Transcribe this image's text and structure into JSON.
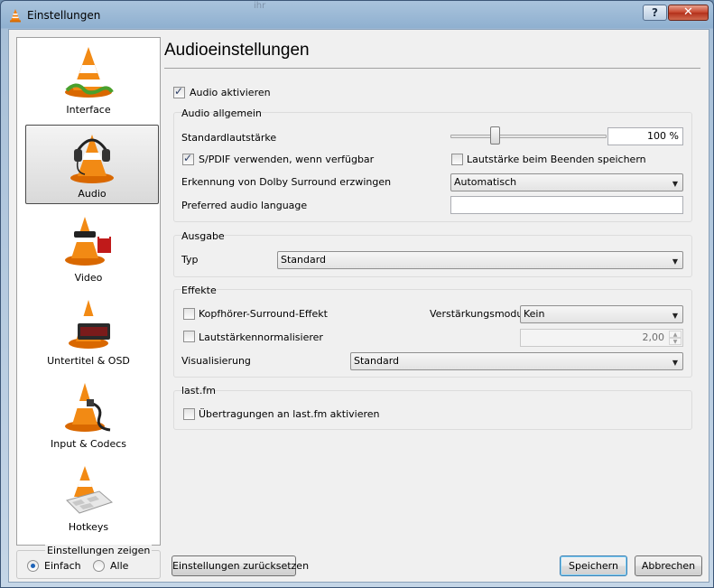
{
  "window": {
    "title": "Einstellungen",
    "behind_title_text": "ihr"
  },
  "titlebar": {
    "help_glyph": "?",
    "close_glyph": "✕"
  },
  "sidebar": {
    "items": [
      {
        "label": "Interface",
        "icon": "vlc-cone-interface-icon"
      },
      {
        "label": "Audio",
        "icon": "vlc-cone-headphones-icon",
        "selected": true
      },
      {
        "label": "Video",
        "icon": "vlc-cone-video-icon"
      },
      {
        "label": "Untertitel & OSD",
        "icon": "vlc-cone-subtitle-icon"
      },
      {
        "label": "Input & Codecs",
        "icon": "vlc-cone-cable-icon"
      },
      {
        "label": "Hotkeys",
        "icon": "vlc-cone-keyboard-icon"
      }
    ]
  },
  "show_settings": {
    "title": "Einstellungen zeigen",
    "simple": "Einfach",
    "all": "Alle",
    "selected": "Einfach"
  },
  "main": {
    "heading": "Audioeinstellungen",
    "enable_audio": {
      "label": "Audio aktivieren",
      "checked": true
    },
    "general": {
      "title": "Audio allgemein",
      "volume_label": "Standardlautstärke",
      "volume_value": "100 %",
      "volume_level": 0.27,
      "spdif": {
        "label": "S/PDIF verwenden, wenn verfügbar",
        "checked": true
      },
      "save_volume": {
        "label": "Lautstärke beim Beenden speichern",
        "checked": false
      },
      "dolby_label": "Erkennung von Dolby Surround erzwingen",
      "dolby_value": "Automatisch",
      "language_label": "Preferred audio language",
      "language_value": ""
    },
    "output": {
      "title": "Ausgabe",
      "type_label": "Typ",
      "type_value": "Standard"
    },
    "effects": {
      "title": "Effekte",
      "headphone": {
        "label": "Kopfhörer-Surround-Effekt",
        "checked": false
      },
      "gain_mode_label": "Verstärkungsmodus",
      "gain_mode_value": "Kein",
      "normalizer": {
        "label": "Lautstärkennormalisierer",
        "checked": false
      },
      "normalizer_value": "2,00",
      "visualization_label": "Visualisierung",
      "visualization_value": "Standard"
    },
    "lastfm": {
      "title": "last.fm",
      "submit": {
        "label": "Übertragungen an last.fm aktivieren",
        "checked": false
      }
    }
  },
  "buttons": {
    "reset": "Einstellungen zurücksetzen",
    "save": "Speichern",
    "cancel": "Abbrechen"
  },
  "colors": {
    "cone_orange": "#f27f0c",
    "selection_border": "#4a4a4a",
    "radio_dot": "#1e63b8"
  }
}
